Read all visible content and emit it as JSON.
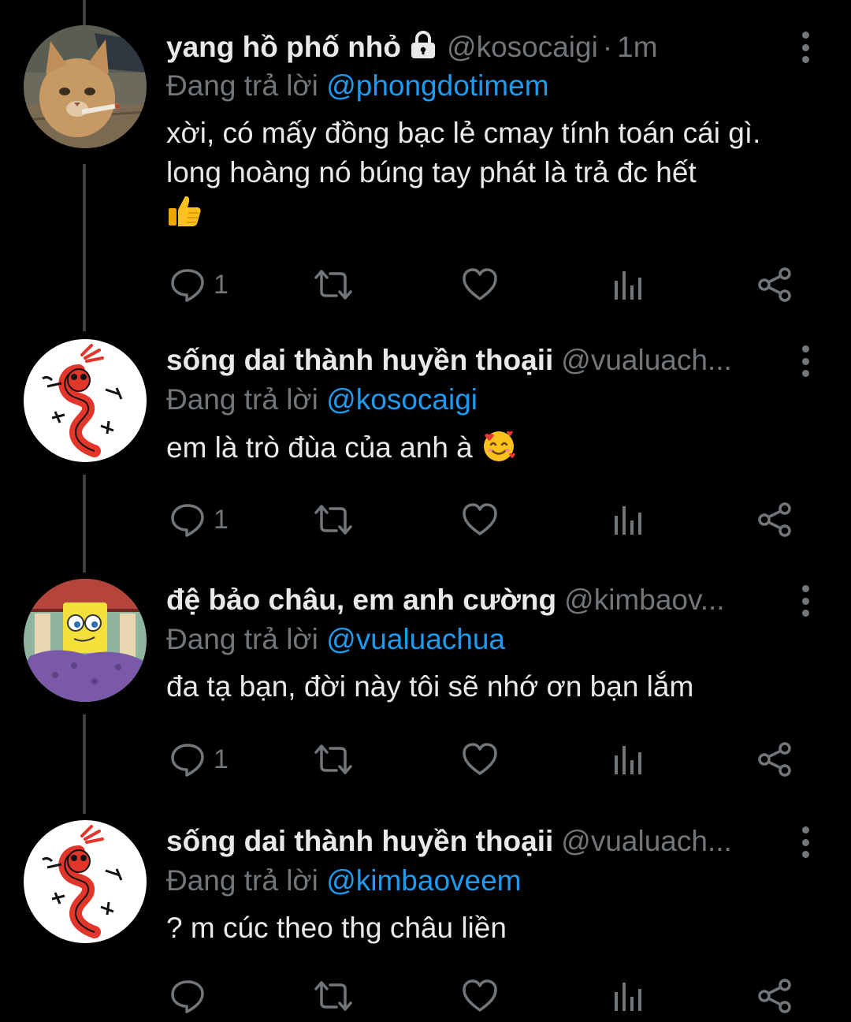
{
  "tweets": [
    {
      "name": "yang hồ phố nhỏ",
      "locked": true,
      "handle": "@kosocaigi",
      "separator": "·",
      "time": "1m",
      "replying_prefix": "Đang trả lời",
      "replying_to": "@phongdotimem",
      "text": "xời, có mấy đồng bạc lẻ cmay tính toán cái gì. long hoàng nó búng tay phát là trả đc hết",
      "emoji": "thumbs-up-emoji",
      "reply_count": "1"
    },
    {
      "name": "sống dai thành huyền thoạii",
      "handle": "@vualuach...",
      "replying_prefix": "Đang trả lời",
      "replying_to": "@kosocaigi",
      "text": "em là trò đùa của anh à",
      "emoji": "smiling-face-with-hearts-emoji",
      "reply_count": "1"
    },
    {
      "name": "đệ bảo châu, em anh cường",
      "handle": "@kimbaov...",
      "replying_prefix": "Đang trả lời",
      "replying_to": "@vualuachua",
      "text": "đa tạ bạn, đời này tôi sẽ nhớ ơn bạn lắm",
      "reply_count": "1"
    },
    {
      "name": "sống dai thành huyền thoạii",
      "handle": "@vualuach...",
      "replying_prefix": "Đang trả lời",
      "replying_to": "@kimbaoveem",
      "text": "? m cúc theo thg châu liền",
      "reply_count": ""
    }
  ],
  "colors": {
    "background": "#000000",
    "text": "#e7e9ea",
    "muted": "#71767b",
    "mention": "#1d9bf0",
    "thread_line": "#3d4043"
  },
  "icons": [
    "lock-icon",
    "more-icon",
    "reply-icon",
    "retweet-icon",
    "like-icon",
    "views-icon",
    "share-icon"
  ]
}
